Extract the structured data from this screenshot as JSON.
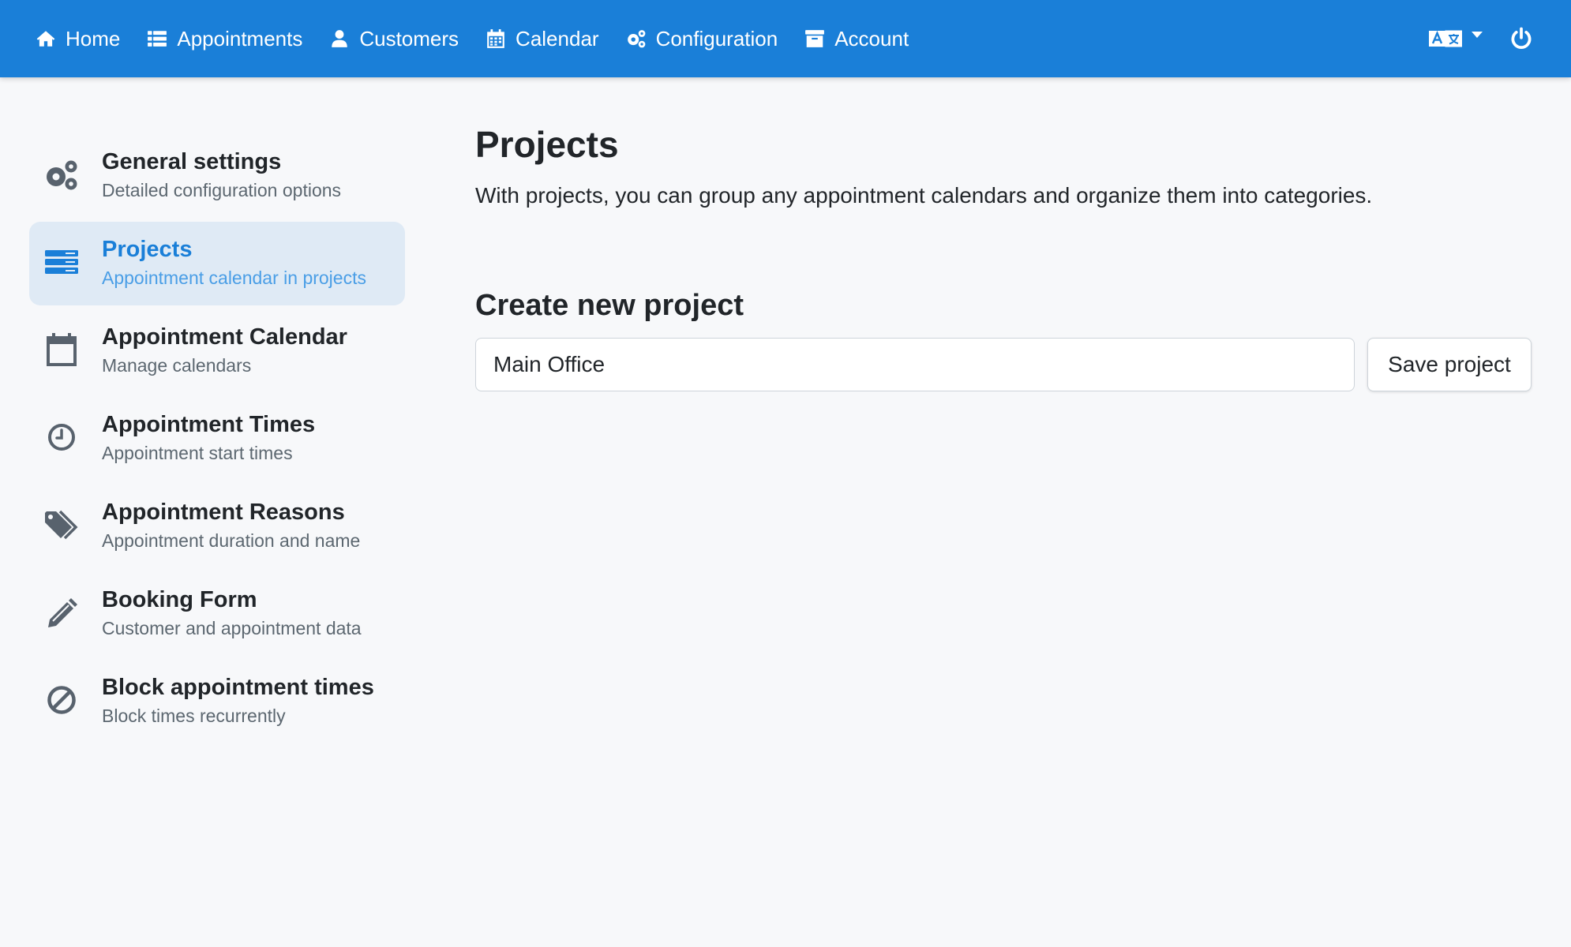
{
  "topbar": {
    "nav": [
      {
        "label": "Home",
        "icon": "home-icon"
      },
      {
        "label": "Appointments",
        "icon": "list-icon"
      },
      {
        "label": "Customers",
        "icon": "user-icon"
      },
      {
        "label": "Calendar",
        "icon": "calendar-grid-icon"
      },
      {
        "label": "Configuration",
        "icon": "cogs-icon"
      },
      {
        "label": "Account",
        "icon": "archive-icon"
      }
    ],
    "language_icon": "translate-icon",
    "power_icon": "power-icon",
    "color": "#1a7fd8"
  },
  "sidebar": {
    "items": [
      {
        "title": "General settings",
        "subtitle": "Detailed configuration options",
        "icon": "cogs-icon",
        "active": false
      },
      {
        "title": "Projects",
        "subtitle": "Appointment calendar in projects",
        "icon": "server-icon",
        "active": true
      },
      {
        "title": "Appointment Calendar",
        "subtitle": "Manage calendars",
        "icon": "calendar-icon",
        "active": false
      },
      {
        "title": "Appointment Times",
        "subtitle": "Appointment start times",
        "icon": "clock-icon",
        "active": false
      },
      {
        "title": "Appointment Reasons",
        "subtitle": "Appointment duration and name",
        "icon": "tags-icon",
        "active": false
      },
      {
        "title": "Booking Form",
        "subtitle": "Customer and appointment data",
        "icon": "pencil-icon",
        "active": false
      },
      {
        "title": "Block appointment times",
        "subtitle": "Block times recurrently",
        "icon": "ban-icon",
        "active": false
      }
    ]
  },
  "main": {
    "title": "Projects",
    "description": "With projects, you can group any appointment calendars and organize them into categories.",
    "create_title": "Create new project",
    "input_value": "Main Office",
    "save_label": "Save project"
  }
}
